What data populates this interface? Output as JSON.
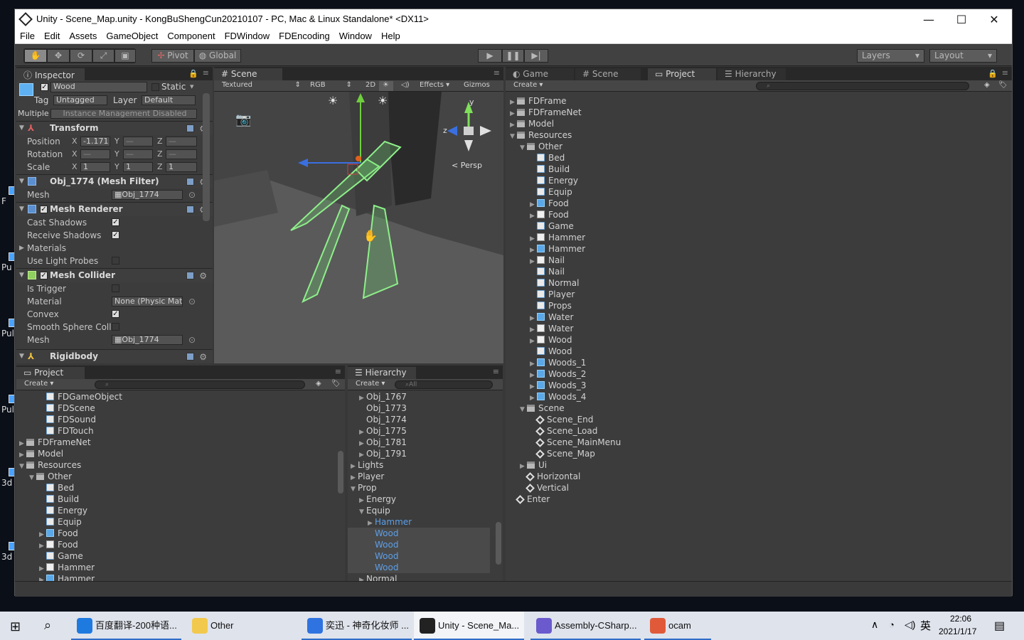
{
  "window": {
    "title": "Unity - Scene_Map.unity - KongBuShengCun20210107 - PC, Mac & Linux Standalone* <DX11>",
    "minimize": "—",
    "maximize": "☐",
    "close": "✕"
  },
  "menu": [
    "File",
    "Edit",
    "Assets",
    "GameObject",
    "Component",
    "FDWindow",
    "FDEncoding",
    "Window",
    "Help"
  ],
  "toolbar": {
    "pivot": "Pivot",
    "global": "Global",
    "layers": "Layers",
    "layout": "Layout"
  },
  "inspector": {
    "tab": "Inspector",
    "object_name": "Wood",
    "static_label": "Static",
    "tag_label": "Tag",
    "tag_value": "Untagged",
    "layer_label": "Layer",
    "layer_value": "Default",
    "multiple_label": "Multiple",
    "instance_mgmt": "Instance Management Disabled",
    "transform": {
      "title": "Transform",
      "position_label": "Position",
      "rotation_label": "Rotation",
      "scale_label": "Scale",
      "pos_x": "-1.171",
      "pos_y": "—",
      "pos_z": "—",
      "rot_x": "—",
      "rot_y": "—",
      "rot_z": "—",
      "scale_x": "1",
      "scale_y": "1",
      "scale_z": "1"
    },
    "mesh_filter": {
      "title": "Obj_1774 (Mesh Filter)",
      "mesh_label": "Mesh",
      "mesh_value": "Obj_1774"
    },
    "mesh_renderer": {
      "title": "Mesh Renderer",
      "cast_shadows": "Cast Shadows",
      "receive_shadows": "Receive Shadows",
      "materials": "Materials",
      "use_light_probes": "Use Light Probes"
    },
    "mesh_collider": {
      "title": "Mesh Collider",
      "is_trigger": "Is Trigger",
      "material_label": "Material",
      "material_value": "None (Physic Mate",
      "convex": "Convex",
      "smooth_sphere": "Smooth Sphere Colli",
      "mesh_label": "Mesh",
      "mesh_value": "Obj_1774"
    },
    "rigidbody": {
      "title": "Rigidbody"
    }
  },
  "scene_tab": {
    "tab": "Scene",
    "shading": "Textured",
    "rgb": "RGB",
    "mode2d": "2D",
    "effects": "Effects",
    "gizmos": "Gizmos",
    "persp": "< Persp",
    "gizmo_y": "y",
    "gizmo_z": "z"
  },
  "right_tabs": {
    "game": "Game",
    "scene": "Scene",
    "project": "Project",
    "hierarchy": "Hierarchy",
    "create": "Create"
  },
  "project_right": [
    {
      "label": "FDFrame",
      "icon": "folder",
      "indent": 0,
      "arrow": "▶"
    },
    {
      "label": "FDFrameNet",
      "icon": "folder",
      "indent": 0,
      "arrow": "▶"
    },
    {
      "label": "Model",
      "icon": "folder",
      "indent": 0,
      "arrow": "▶"
    },
    {
      "label": "Resources",
      "icon": "folder",
      "indent": 0,
      "arrow": "▼"
    },
    {
      "label": "Other",
      "icon": "folder",
      "indent": 1,
      "arrow": "▼"
    },
    {
      "label": "Bed",
      "icon": "script",
      "indent": 2,
      "arrow": ""
    },
    {
      "label": "Build",
      "icon": "script",
      "indent": 2,
      "arrow": ""
    },
    {
      "label": "Energy",
      "icon": "script",
      "indent": 2,
      "arrow": ""
    },
    {
      "label": "Equip",
      "icon": "script",
      "indent": 2,
      "arrow": ""
    },
    {
      "label": "Food",
      "icon": "prefab",
      "indent": 2,
      "arrow": "▶"
    },
    {
      "label": "Food",
      "icon": "mat",
      "indent": 2,
      "arrow": "▶"
    },
    {
      "label": "Game",
      "icon": "script",
      "indent": 2,
      "arrow": ""
    },
    {
      "label": "Hammer",
      "icon": "mat",
      "indent": 2,
      "arrow": "▶"
    },
    {
      "label": "Hammer",
      "icon": "prefab",
      "indent": 2,
      "arrow": "▶"
    },
    {
      "label": "Nail",
      "icon": "mat",
      "indent": 2,
      "arrow": "▶"
    },
    {
      "label": "Nail",
      "icon": "script",
      "indent": 2,
      "arrow": ""
    },
    {
      "label": "Normal",
      "icon": "script",
      "indent": 2,
      "arrow": ""
    },
    {
      "label": "Player",
      "icon": "script",
      "indent": 2,
      "arrow": ""
    },
    {
      "label": "Props",
      "icon": "script",
      "indent": 2,
      "arrow": ""
    },
    {
      "label": "Water",
      "icon": "prefab",
      "indent": 2,
      "arrow": "▶"
    },
    {
      "label": "Water",
      "icon": "mat",
      "indent": 2,
      "arrow": "▶"
    },
    {
      "label": "Wood",
      "icon": "mat",
      "indent": 2,
      "arrow": "▶"
    },
    {
      "label": "Wood",
      "icon": "script",
      "indent": 2,
      "arrow": ""
    },
    {
      "label": "Woods_1",
      "icon": "prefab",
      "indent": 2,
      "arrow": "▶"
    },
    {
      "label": "Woods_2",
      "icon": "prefab",
      "indent": 2,
      "arrow": "▶"
    },
    {
      "label": "Woods_3",
      "icon": "prefab",
      "indent": 2,
      "arrow": "▶"
    },
    {
      "label": "Woods_4",
      "icon": "prefab",
      "indent": 2,
      "arrow": "▶"
    },
    {
      "label": "Scene",
      "icon": "folder",
      "indent": 1,
      "arrow": "▼"
    },
    {
      "label": "Scene_End",
      "icon": "scene",
      "indent": 2,
      "arrow": ""
    },
    {
      "label": "Scene_Load",
      "icon": "scene",
      "indent": 2,
      "arrow": ""
    },
    {
      "label": "Scene_MainMenu",
      "icon": "scene",
      "indent": 2,
      "arrow": ""
    },
    {
      "label": "Scene_Map",
      "icon": "scene",
      "indent": 2,
      "arrow": ""
    },
    {
      "label": "Ui",
      "icon": "folder",
      "indent": 1,
      "arrow": "▶"
    },
    {
      "label": "Horizontal",
      "icon": "scene",
      "indent": 1,
      "arrow": ""
    },
    {
      "label": "Vertical",
      "icon": "scene",
      "indent": 1,
      "arrow": ""
    },
    {
      "label": "Enter",
      "icon": "scene",
      "indent": 0,
      "arrow": ""
    }
  ],
  "project_bottom": {
    "tab": "Project",
    "create": "Create",
    "items": [
      {
        "label": "FDGameObject",
        "icon": "script",
        "indent": 2,
        "arrow": ""
      },
      {
        "label": "FDScene",
        "icon": "script",
        "indent": 2,
        "arrow": ""
      },
      {
        "label": "FDSound",
        "icon": "script",
        "indent": 2,
        "arrow": ""
      },
      {
        "label": "FDTouch",
        "icon": "script",
        "indent": 2,
        "arrow": ""
      },
      {
        "label": "FDFrameNet",
        "icon": "folder",
        "indent": 0,
        "arrow": "▶"
      },
      {
        "label": "Model",
        "icon": "folder",
        "indent": 0,
        "arrow": "▶"
      },
      {
        "label": "Resources",
        "icon": "folder",
        "indent": 0,
        "arrow": "▼"
      },
      {
        "label": "Other",
        "icon": "folder",
        "indent": 1,
        "arrow": "▼"
      },
      {
        "label": "Bed",
        "icon": "script",
        "indent": 2,
        "arrow": ""
      },
      {
        "label": "Build",
        "icon": "script",
        "indent": 2,
        "arrow": ""
      },
      {
        "label": "Energy",
        "icon": "script",
        "indent": 2,
        "arrow": ""
      },
      {
        "label": "Equip",
        "icon": "script",
        "indent": 2,
        "arrow": ""
      },
      {
        "label": "Food",
        "icon": "prefab",
        "indent": 2,
        "arrow": "▶"
      },
      {
        "label": "Food",
        "icon": "mat",
        "indent": 2,
        "arrow": "▶"
      },
      {
        "label": "Game",
        "icon": "script",
        "indent": 2,
        "arrow": ""
      },
      {
        "label": "Hammer",
        "icon": "mat",
        "indent": 2,
        "arrow": "▶"
      },
      {
        "label": "Hammer",
        "icon": "prefab",
        "indent": 2,
        "arrow": "▶"
      }
    ]
  },
  "hierarchy_bottom": {
    "tab": "Hierarchy",
    "create": "Create",
    "search": "All",
    "items": [
      {
        "label": "Obj_1767",
        "indent": 1,
        "arrow": "▶",
        "style": ""
      },
      {
        "label": "Obj_1773",
        "indent": 1,
        "arrow": "",
        "style": ""
      },
      {
        "label": "Obj_1774",
        "indent": 1,
        "arrow": "",
        "style": ""
      },
      {
        "label": "Obj_1775",
        "indent": 1,
        "arrow": "▶",
        "style": ""
      },
      {
        "label": "Obj_1781",
        "indent": 1,
        "arrow": "▶",
        "style": ""
      },
      {
        "label": "Obj_1791",
        "indent": 1,
        "arrow": "▶",
        "style": ""
      },
      {
        "label": "Lights",
        "indent": 0,
        "arrow": "▶",
        "style": ""
      },
      {
        "label": "Player",
        "indent": 0,
        "arrow": "▶",
        "style": ""
      },
      {
        "label": "Prop",
        "indent": 0,
        "arrow": "▼",
        "style": ""
      },
      {
        "label": "Energy",
        "indent": 1,
        "arrow": "▶",
        "style": ""
      },
      {
        "label": "Equip",
        "indent": 1,
        "arrow": "▼",
        "style": ""
      },
      {
        "label": "Hammer",
        "indent": 2,
        "arrow": "▶",
        "style": "blue"
      },
      {
        "label": "Wood",
        "indent": 2,
        "arrow": "",
        "style": "sel"
      },
      {
        "label": "Wood",
        "indent": 2,
        "arrow": "",
        "style": "sel"
      },
      {
        "label": "Wood",
        "indent": 2,
        "arrow": "",
        "style": "sel"
      },
      {
        "label": "Wood",
        "indent": 2,
        "arrow": "",
        "style": "sel"
      },
      {
        "label": "Normal",
        "indent": 1,
        "arrow": "▶",
        "style": ""
      }
    ]
  },
  "taskbar": {
    "items": [
      {
        "label": "百度翻译-200种语...",
        "color": "#1f7ae0",
        "state": "open"
      },
      {
        "label": "Other",
        "color": "#f2c94c",
        "state": ""
      },
      {
        "label": "奕迅 - 神奇化妆师 ...",
        "color": "#2f73e0",
        "state": "open"
      },
      {
        "label": "Unity - Scene_Ma...",
        "color": "#222222",
        "state": "active"
      },
      {
        "label": "Assembly-CSharp...",
        "color": "#6a5acd",
        "state": "open"
      },
      {
        "label": "ocam",
        "color": "#e05a3a",
        "state": "open"
      }
    ],
    "ime": "英",
    "time": "22:06",
    "date": "2021/1/17"
  },
  "desktop_labels": [
    "F",
    "Pu",
    "Pul",
    "Pul",
    "3d",
    "3d"
  ]
}
